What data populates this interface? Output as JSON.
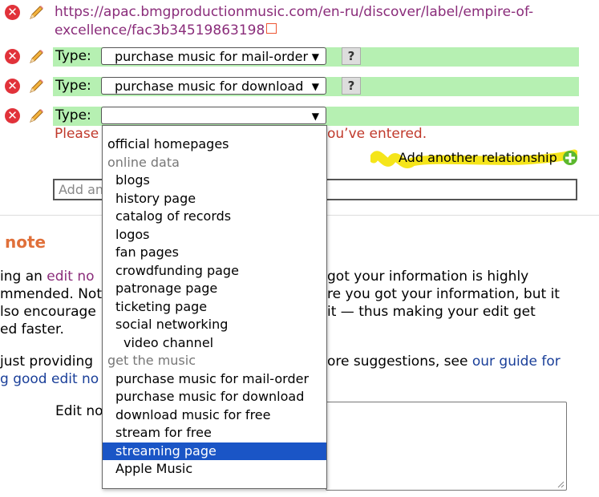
{
  "url_text": "https://apac.bmgproductionmusic.com/en-ru/discover/label/empire-of-excellence/fac3b34519863198",
  "relationships": [
    {
      "type_label": "Type:",
      "selected": "purchase music for mail-order",
      "help": "?"
    },
    {
      "type_label": "Type:",
      "selected": "purchase music for download",
      "help": "?"
    },
    {
      "type_label": "Type:",
      "selected": ""
    }
  ],
  "error_visible": [
    "Please",
    "ou’ve entered."
  ],
  "add_relationship": "Add another relationship",
  "add_link_placeholder": "Add an",
  "edit_note_heading": "note",
  "paragraph1": [
    {
      "a": "ing an ",
      "b": "edit no",
      "c": "",
      "d": "got your information is highly"
    },
    {
      "a": "mmended. Not",
      "b": "",
      "c": "",
      "d": "re you got your information, but it"
    },
    {
      "a": "lso encourage",
      "b": "",
      "c": "",
      "d": "it — thus making your edit get"
    },
    {
      "a": "ed faster.",
      "b": "",
      "c": "",
      "d": ""
    }
  ],
  "paragraph2": {
    "line1_a": "just providing",
    "line1_b": "ore suggestions, see ",
    "line1_link": "our guide for",
    "line2_link": "g good edit no"
  },
  "edit_note_label": "Edit no",
  "dropdown_options": [
    {
      "label": "",
      "kind": "blank"
    },
    {
      "label": "official homepages",
      "kind": "option",
      "indent": 0
    },
    {
      "label": "online data",
      "kind": "group",
      "indent": 0
    },
    {
      "label": "blogs",
      "kind": "option",
      "indent": 1
    },
    {
      "label": "history page",
      "kind": "option",
      "indent": 1
    },
    {
      "label": "catalog of records",
      "kind": "option",
      "indent": 1
    },
    {
      "label": "logos",
      "kind": "option",
      "indent": 1
    },
    {
      "label": "fan pages",
      "kind": "option",
      "indent": 1
    },
    {
      "label": "crowdfunding page",
      "kind": "option",
      "indent": 1
    },
    {
      "label": "patronage page",
      "kind": "option",
      "indent": 1
    },
    {
      "label": "ticketing page",
      "kind": "option",
      "indent": 1
    },
    {
      "label": "social networking",
      "kind": "option",
      "indent": 1
    },
    {
      "label": "video channel",
      "kind": "option",
      "indent": 2
    },
    {
      "label": "get the music",
      "kind": "group",
      "indent": 0
    },
    {
      "label": "purchase music for mail-order",
      "kind": "option",
      "indent": 1
    },
    {
      "label": "purchase music for download",
      "kind": "option",
      "indent": 1
    },
    {
      "label": "download music for free",
      "kind": "option",
      "indent": 1
    },
    {
      "label": "stream for free",
      "kind": "option",
      "indent": 1
    },
    {
      "label": "streaming page",
      "kind": "option",
      "indent": 1,
      "selected": true
    },
    {
      "label": "Apple Music",
      "kind": "option",
      "indent": 1
    }
  ],
  "colors": {
    "remove": "#e1323a",
    "row_bg": "#b6f0b2",
    "selected_bg": "#1a55c6",
    "heading": "#e0703a",
    "link": "#1a3f99",
    "error": "#c0392b",
    "highlight": "#f5e51a"
  }
}
